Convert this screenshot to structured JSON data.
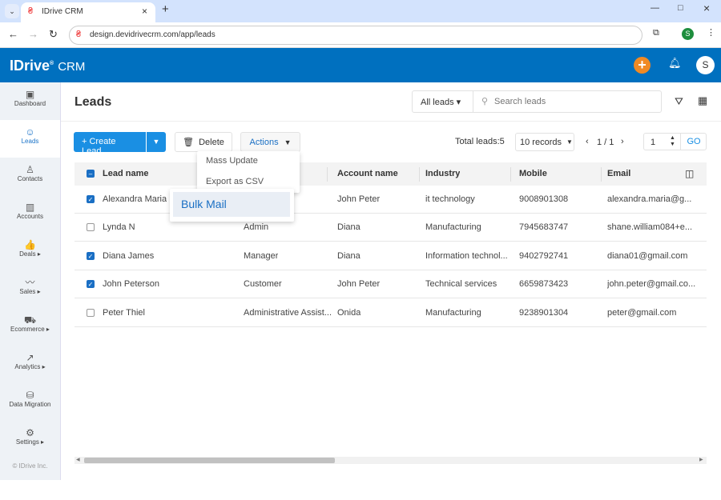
{
  "browser": {
    "tab_title": "IDrive CRM",
    "url": "design.devidrivecrm.com/app/leads",
    "profile": "S"
  },
  "app": {
    "logo": "IDrive® CRM",
    "logo_text": "IDrive",
    "logo_suffix": "CRM",
    "avatar": "S",
    "accent": "#0070bf",
    "add_color": "#f08a24"
  },
  "sidebar": {
    "items": [
      {
        "label": "Dashboard",
        "icon": "dashboard-icon",
        "glyph": "▣"
      },
      {
        "label": "Leads",
        "icon": "leads-icon",
        "glyph": "☺",
        "active": true
      },
      {
        "label": "Contacts",
        "icon": "contacts-icon",
        "glyph": "♙"
      },
      {
        "label": "Accounts",
        "icon": "accounts-icon",
        "glyph": "▥"
      },
      {
        "label": "Deals ▸",
        "icon": "thumbs-up-icon",
        "glyph": "👍"
      },
      {
        "label": "Sales ▸",
        "icon": "pulse-icon",
        "glyph": "〰"
      },
      {
        "label": "Ecommerce ▸",
        "icon": "cart-icon",
        "glyph": "⛟"
      },
      {
        "label": "Analytics ▸",
        "icon": "analytics-icon",
        "glyph": "↗"
      },
      {
        "label": "Data Migration",
        "icon": "database-icon",
        "glyph": "⛁"
      },
      {
        "label": "Settings ▸",
        "icon": "gear-icon",
        "glyph": "⚙"
      }
    ],
    "footer": "© IDrive Inc."
  },
  "page": {
    "title": "Leads",
    "filter": "All leads",
    "search_placeholder": "Search leads"
  },
  "toolbar": {
    "create": "Create Lead",
    "delete": "Delete",
    "actions": "Actions",
    "total_label": "Total leads:",
    "total": "5",
    "records": "10 records",
    "page": "1 / 1",
    "page_input": "1",
    "go": "GO"
  },
  "actions_menu": {
    "items": [
      "Mass Update",
      "Export as CSV"
    ],
    "submenu": "Bulk Mail"
  },
  "table": {
    "headers": [
      "Lead name",
      "",
      "Account name",
      "Industry",
      "Mobile",
      "Email"
    ],
    "rows": [
      {
        "checked": true,
        "name": "Alexandra Maria",
        "title": "",
        "account": "John Peter",
        "industry": "it technology",
        "mobile": "9008901308",
        "email": "alexandra.maria@g..."
      },
      {
        "checked": false,
        "name": "Lynda N",
        "title": "Admin",
        "account": "Diana",
        "industry": "Manufacturing",
        "mobile": "7945683747",
        "email": "shane.william084+e..."
      },
      {
        "checked": true,
        "name": "Diana James",
        "title": "Manager",
        "account": "Diana",
        "industry": "Information technol...",
        "mobile": "9402792741",
        "email": "diana01@gmail.com"
      },
      {
        "checked": true,
        "name": "John Peterson",
        "title": "Customer",
        "account": "John Peter",
        "industry": "Technical services",
        "mobile": "6659873423",
        "email": "john.peter@gmail.co..."
      },
      {
        "checked": false,
        "name": "Peter Thiel",
        "title": "Administrative Assist...",
        "account": "Onida",
        "industry": "Manufacturing",
        "mobile": "9238901304",
        "email": "peter@gmail.com"
      }
    ]
  }
}
